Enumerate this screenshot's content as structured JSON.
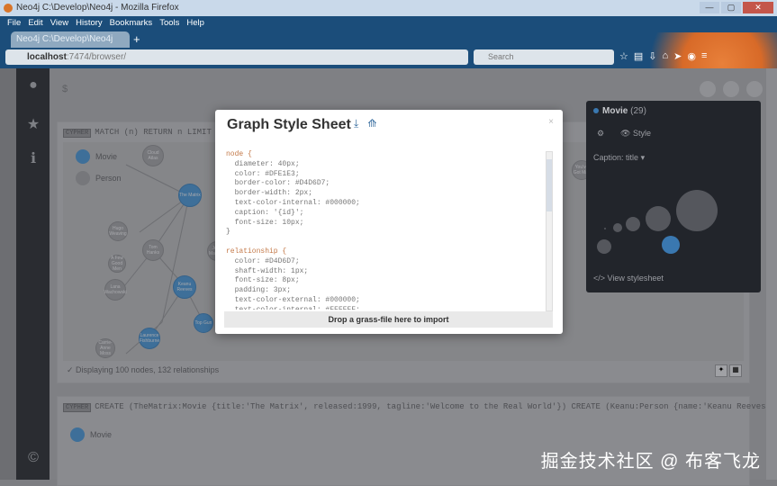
{
  "window": {
    "title": "Neo4j C:\\Develop\\Neo4j - Mozilla Firefox",
    "controls": [
      "—",
      "▢",
      "✕"
    ]
  },
  "menu": [
    "File",
    "Edit",
    "View",
    "History",
    "Bookmarks",
    "Tools",
    "Help"
  ],
  "tab": {
    "label": "Neo4j C:\\Develop\\Neo4j",
    "new_tab": "+"
  },
  "url": {
    "host": "localhost",
    "path": ":7474/browser/"
  },
  "search": {
    "placeholder": "Search"
  },
  "editor": {
    "prompt": "$"
  },
  "frame1": {
    "badge": "CYPHER",
    "command": "MATCH (n) RETURN n LIMIT 100",
    "legend": [
      "Movie",
      "Person"
    ],
    "status": "Displaying 100 nodes, 132 relationships",
    "nodes": [
      "Cloud Atlas",
      "The Matrix",
      "Tom Hanks",
      "Lana Wachowski",
      "Keanu Reeves",
      "Hugo Weaving",
      "Laurence Fishburne",
      "Carrie-Anne Moss",
      "You've Got Mail",
      "Top Gun",
      "A Few Good Men",
      "Jerry Maguire"
    ]
  },
  "frame2": {
    "badge": "CYPHER",
    "command": "CREATE (TheMatrix:Movie {title:'The Matrix', released:1999, tagline:'Welcome to the Real World'}) CREATE (Keanu:Person {name:'Keanu Reeves',",
    "legend": "Movie"
  },
  "panel": {
    "label": "Movie",
    "count": "(29)",
    "style_label": "Style",
    "caption_label": "Caption:",
    "caption_value": "title",
    "view_stylesheet": "View stylesheet"
  },
  "modal": {
    "title": "Graph Style Sheet",
    "close": "×",
    "drop_text": "Drop a grass-file here to import",
    "code": [
      "node {",
      "  diameter: 40px;",
      "  color: #DFE1E3;",
      "  border-color: #D4D6D7;",
      "  border-width: 2px;",
      "  text-color-internal: #000000;",
      "  caption: '{id}';",
      "  font-size: 10px;",
      "}",
      "",
      "relationship {",
      "  color: #D4D6D7;",
      "  shaft-width: 1px;",
      "  font-size: 8px;",
      "  padding: 3px;",
      "  text-color-external: #000000;",
      "  text-color-internal: #FFFFFF;"
    ]
  },
  "watermark": "掘金技术社区 @ 布客飞龙",
  "colors": {
    "accent": "#3a78b0",
    "menubar": "#1b4d7a"
  }
}
